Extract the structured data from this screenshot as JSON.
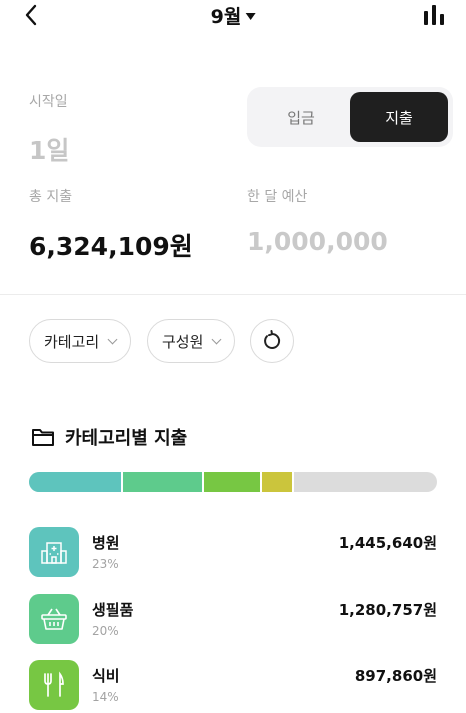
{
  "header": {
    "month_label": "9월"
  },
  "start": {
    "label": "시작일",
    "value": "1일"
  },
  "toggle": {
    "deposit_label": "입금",
    "expense_label": "지출"
  },
  "total": {
    "label": "총 지출",
    "value": "6,324,109원"
  },
  "budget": {
    "label": "한 달 예산",
    "value": "1,000,000"
  },
  "filters": {
    "category_label": "카테고리",
    "member_label": "구성원"
  },
  "section": {
    "title": "카테고리별 지출"
  },
  "breakdown_bar": [
    {
      "share": 23,
      "color": "#5ec4bd"
    },
    {
      "share": 20,
      "color": "#5ecb8c"
    },
    {
      "share": 14,
      "color": "#77c743"
    },
    {
      "share": 8,
      "color": "#cbc53c"
    }
  ],
  "categories": [
    {
      "name": "병원",
      "percent": "23%",
      "amount": "1,445,640원",
      "color": "#5ec4bd",
      "icon": "hospital-icon"
    },
    {
      "name": "생필품",
      "percent": "20%",
      "amount": "1,280,757원",
      "color": "#5ecb8c",
      "icon": "basket-icon"
    },
    {
      "name": "식비",
      "percent": "14%",
      "amount": "897,860원",
      "color": "#77c743",
      "icon": "utensils-icon"
    }
  ]
}
